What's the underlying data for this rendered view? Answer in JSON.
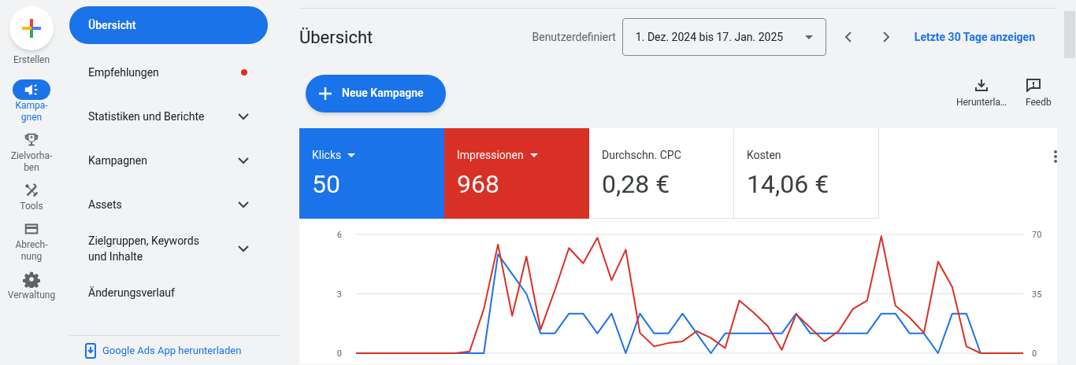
{
  "rail": {
    "create_label": "Erstellen",
    "items": [
      {
        "label": "Kampa-\ngnen",
        "selected": true
      },
      {
        "label": "Zielvorha-\nben",
        "selected": false
      },
      {
        "label": "Tools",
        "selected": false
      },
      {
        "label": "Abrech-\nnung",
        "selected": false
      },
      {
        "label": "Verwaltung",
        "selected": false
      }
    ]
  },
  "nav": {
    "items": [
      {
        "label": "Übersicht",
        "selected": true,
        "expandable": false,
        "notification": false
      },
      {
        "label": "Empfehlungen",
        "selected": false,
        "expandable": false,
        "notification": true
      },
      {
        "label": "Statistiken und Berichte",
        "selected": false,
        "expandable": true,
        "notification": false
      },
      {
        "label": "Kampagnen",
        "selected": false,
        "expandable": true,
        "notification": false
      },
      {
        "label": "Assets",
        "selected": false,
        "expandable": true,
        "notification": false
      },
      {
        "label": "Zielgruppen, Keywords und Inhalte",
        "selected": false,
        "expandable": true,
        "notification": false
      },
      {
        "label": "Änderungsverlauf",
        "selected": false,
        "expandable": false,
        "notification": false
      }
    ],
    "footer_link": "Google Ads App herunterladen"
  },
  "header": {
    "title": "Übersicht",
    "range_label": "Benutzerdefiniert",
    "date_range": "1. Dez. 2024 bis 17. Jan. 2025",
    "last_30_link": "Letzte 30 Tage anzeigen"
  },
  "new_campaign_button": "Neue Kampagne",
  "toolbar": [
    {
      "label": "Herunterla…"
    },
    {
      "label": "Feedb"
    }
  ],
  "metrics": [
    {
      "label": "Klicks",
      "value": "50",
      "selected": true,
      "color": "#1a73e8"
    },
    {
      "label": "Impressionen",
      "value": "968",
      "selected": true,
      "color": "#d93025"
    },
    {
      "label": "Durchschn. CPC",
      "value": "0,28 €",
      "selected": false
    },
    {
      "label": "Kosten",
      "value": "14,06 €",
      "selected": false
    }
  ],
  "chart_data": {
    "type": "line",
    "ylim": [
      0,
      6
    ],
    "yticks": [
      0,
      3,
      6
    ],
    "y2lim": [
      0,
      70
    ],
    "y2ticks": [
      0,
      35,
      70
    ],
    "series": [
      {
        "color": "#1a73e8",
        "values": [
          null,
          null,
          null,
          null,
          null,
          null,
          0,
          0,
          0,
          0,
          5,
          4,
          3,
          1,
          1,
          2,
          2,
          1,
          2,
          0,
          2,
          1,
          1,
          2,
          1,
          0,
          1,
          1,
          1,
          1,
          1,
          2,
          1,
          1,
          1,
          1,
          1,
          2,
          2,
          1,
          1,
          0,
          2,
          2,
          0,
          0,
          null,
          null
        ]
      },
      {
        "color": "#d93025",
        "axis": "y2",
        "values": [
          0,
          0,
          0,
          0,
          0,
          0,
          0,
          0,
          1,
          26,
          64,
          22,
          57,
          14,
          37,
          62,
          53,
          68,
          43,
          61,
          12,
          4,
          6,
          7,
          13,
          9,
          3,
          31,
          24,
          16,
          2,
          23,
          15,
          7,
          13,
          26,
          31,
          69,
          28,
          21,
          12,
          54,
          39,
          4,
          0,
          0,
          0,
          0
        ]
      }
    ]
  }
}
